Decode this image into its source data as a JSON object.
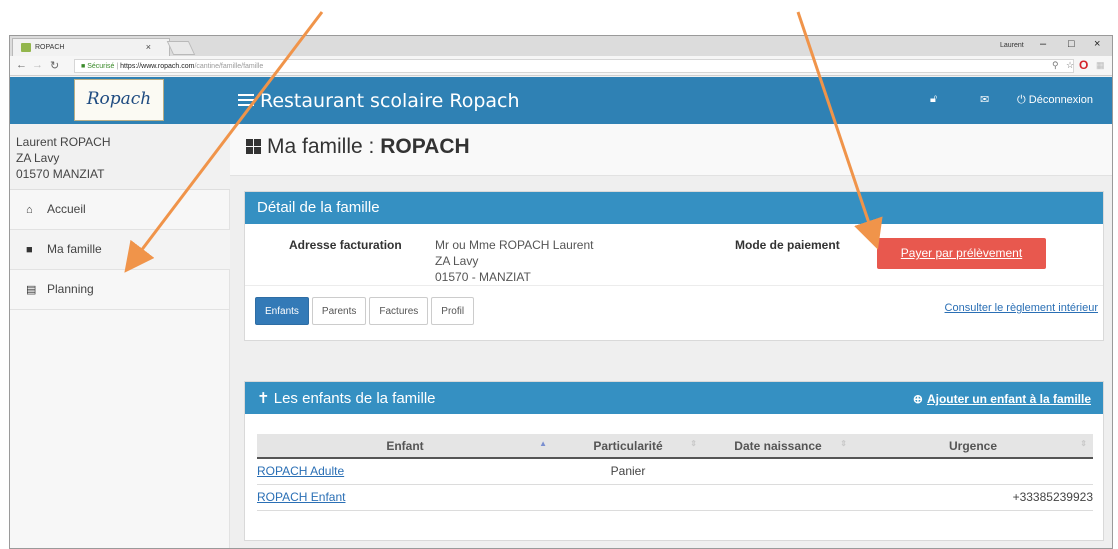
{
  "browser": {
    "tab_title": "ROPACH",
    "tab_close": "×",
    "user_label": "Laurent",
    "window_controls": [
      "–",
      "□",
      "×"
    ],
    "url_secure": "Sécurisé",
    "url_host": "https://www.ropach.com",
    "url_path": "/cantine/famille/famille"
  },
  "app": {
    "logo_text": "Ropach",
    "title": "Restaurant scolaire Ropach",
    "logout_label": "Déconnexion",
    "user": {
      "name": "Laurent ROPACH",
      "address": "ZA Lavy",
      "city": "01570 MANZIAT"
    },
    "menu": [
      {
        "label": "Accueil",
        "icon": "home-icon"
      },
      {
        "label": "Ma famille",
        "icon": "grid-icon"
      },
      {
        "label": "Planning",
        "icon": "calendar-icon"
      }
    ]
  },
  "page": {
    "title_prefix": "Ma famille : ",
    "title_name": "ROPACH"
  },
  "detail": {
    "heading": "Détail de la famille",
    "billing_label": "Adresse facturation",
    "billing_lines": [
      "Mr ou Mme ROPACH Laurent",
      "ZA Lavy",
      "01570 - MANZIAT"
    ],
    "payment_label": "Mode de paiement",
    "pay_button": "Payer par prélèvement",
    "tabs": [
      "Enfants",
      "Parents",
      "Factures",
      "Profil"
    ],
    "active_tab": "Enfants",
    "reglement_link": "Consulter le règlement intérieur"
  },
  "children": {
    "heading": "Les enfants de la famille",
    "add_link": "Ajouter un enfant à la famille",
    "columns": [
      "Enfant",
      "Particularité",
      "Date naissance",
      "Urgence"
    ],
    "rows": [
      {
        "enfant": "ROPACH Adulte",
        "particularite": "Panier",
        "naissance": "",
        "urgence": ""
      },
      {
        "enfant": "ROPACH Enfant",
        "particularite": "",
        "naissance": "",
        "urgence": "+33385239923"
      }
    ]
  },
  "colors": {
    "primary_blue": "#2f81b4",
    "panel_blue": "#3590c2",
    "pay_red": "#e8584e",
    "arrow_orange": "#f0944a"
  }
}
